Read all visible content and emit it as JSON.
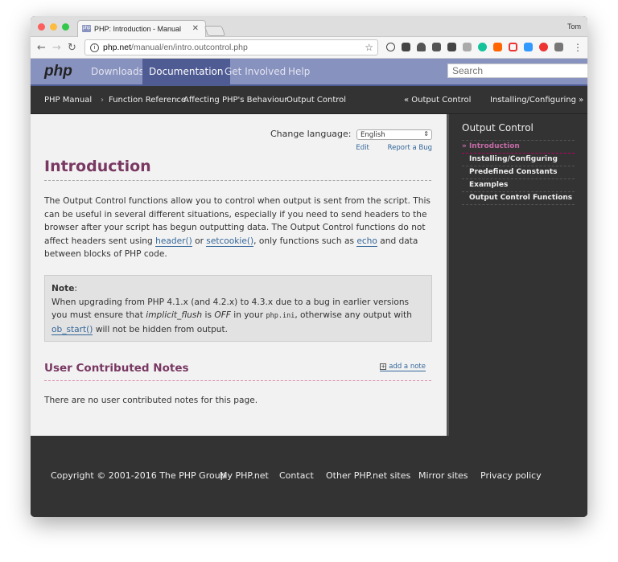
{
  "browser": {
    "tab_title": "PHP: Introduction - Manual",
    "favicon": "php",
    "user": "Tom",
    "url_host": "php.net",
    "url_path": "/manual/en/intro.outcontrol.php"
  },
  "header": {
    "logo": "php",
    "menu": [
      "Downloads",
      "Documentation",
      "Get Involved",
      "Help"
    ],
    "active": "Documentation",
    "search_placeholder": "Search"
  },
  "breadcrumb": {
    "items": [
      "PHP Manual",
      "Function Reference",
      "Affecting PHP's Behaviour",
      "Output Control"
    ],
    "separator": "›",
    "prev": "« Output Control",
    "next": "Installing/Configuring »"
  },
  "main": {
    "change_language_label": "Change language:",
    "language": "English",
    "edit": "Edit",
    "report_bug": "Report a Bug",
    "title": "Introduction",
    "para": {
      "t1": "The Output Control functions allow you to control when output is sent from the script. This can be useful in several different situations, especially if you need to send headers to the browser after your script has begun outputting data. The Output Control functions do not affect headers sent using ",
      "l1": "header()",
      "t2": " or ",
      "l2": "setcookie()",
      "t3": ", only functions such as ",
      "l3": "echo",
      "t4": " and data between blocks of PHP code."
    },
    "note": {
      "label": "Note",
      "colon": ":",
      "t1": "When upgrading from PHP 4.1.x (and 4.2.x) to 4.3.x due to a bug in earlier versions you must ensure that ",
      "em1": "implicit_flush",
      "t2": " is ",
      "em2": "OFF",
      "t3": " in your ",
      "code": "php.ini",
      "t4": ", otherwise any output with ",
      "link": "ob_start()",
      "t5": " will not be hidden from output."
    },
    "notes_title": "User Contributed Notes",
    "add_note": "add a note",
    "no_notes": "There are no user contributed notes for this page."
  },
  "sidebar": {
    "title": "Output Control",
    "items": [
      "» Introduction",
      "Installing/Configuring",
      "Predefined Constants",
      "Examples",
      "Output Control Functions"
    ]
  },
  "footer": {
    "items": [
      "Copyright © 2001-2016 The PHP Group",
      "My PHP.net",
      "Contact",
      "Other PHP.net sites",
      "Mirror sites",
      "Privacy policy"
    ]
  },
  "colors": {
    "header": "#8892bf",
    "active_menu": "#4f5b93",
    "title": "#793862",
    "link": "#336699",
    "dark": "#333333"
  }
}
